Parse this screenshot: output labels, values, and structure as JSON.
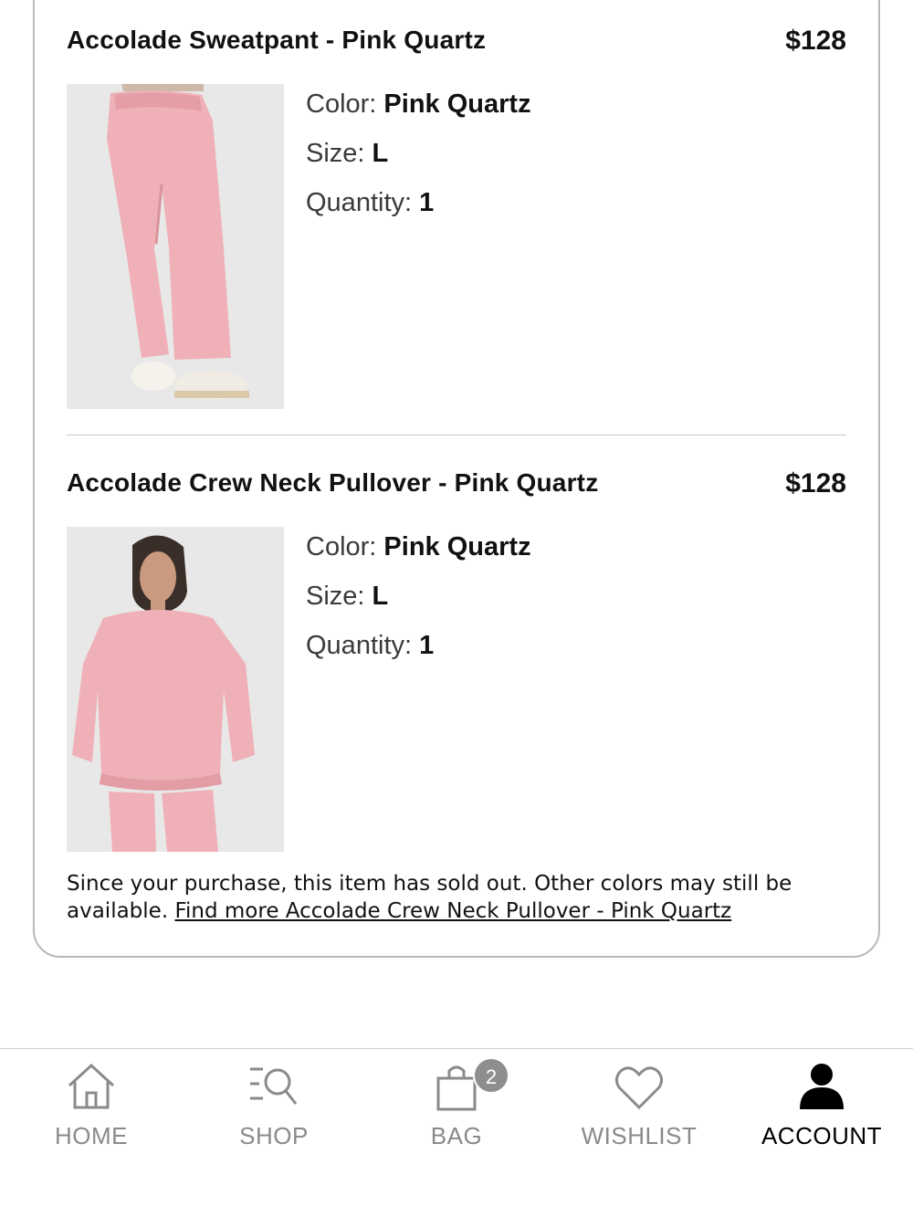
{
  "order": {
    "items": [
      {
        "title": "Accolade Sweatpant - Pink Quartz",
        "price": "$128",
        "color_label": "Color:",
        "color_value": "Pink Quartz",
        "size_label": "Size:",
        "size_value": "L",
        "qty_label": "Quantity:",
        "qty_value": "1"
      },
      {
        "title": "Accolade Crew Neck Pullover - Pink Quartz",
        "price": "$128",
        "color_label": "Color:",
        "color_value": "Pink Quartz",
        "size_label": "Size:",
        "size_value": "L",
        "qty_label": "Quantity:",
        "qty_value": "1"
      }
    ],
    "soldout_text": "Since your purchase, this item has sold out. Other colors may still be available.",
    "soldout_link": "Find more Accolade Crew Neck Pullover - Pink Quartz"
  },
  "tabbar": {
    "tabs": [
      {
        "label": "HOME",
        "icon": "home-icon"
      },
      {
        "label": "SHOP",
        "icon": "shop-search-icon"
      },
      {
        "label": "BAG",
        "icon": "bag-icon",
        "badge": "2"
      },
      {
        "label": "WISHLIST",
        "icon": "heart-icon"
      },
      {
        "label": "ACCOUNT",
        "icon": "account-icon",
        "active": true
      }
    ]
  },
  "colors": {
    "product_pink": "#efb1b7",
    "inactive_tab": "#8a8a8a",
    "active_tab": "#000000",
    "badge": "#8e8e8e"
  }
}
